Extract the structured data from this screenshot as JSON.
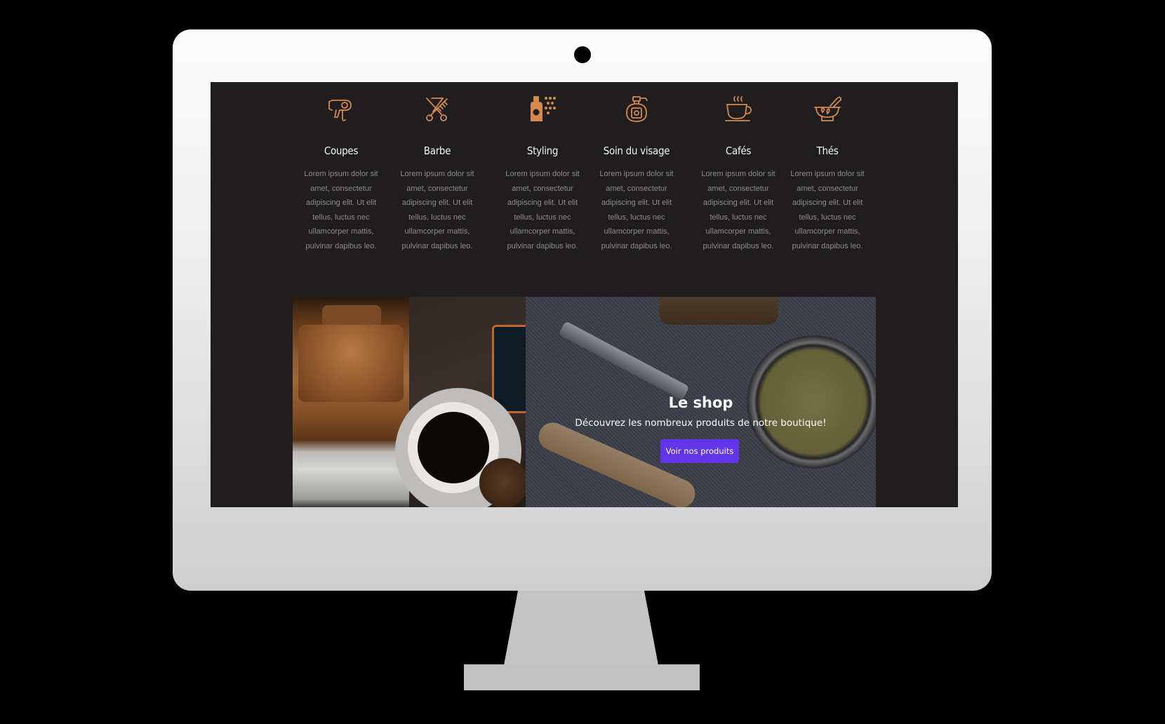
{
  "brand": {
    "accent_color": "#d58a4c",
    "button_color": "#6235e8",
    "screen_background": "#1f1d1e"
  },
  "services": [
    {
      "icon": "hair-dryer-icon",
      "title": "Coupes",
      "text": "Lorem ipsum dolor sit amet, consectetur adipiscing elit. Ut elit tellus, luctus nec ullamcorper mattis, pulvinar dapibus leo."
    },
    {
      "icon": "scissors-comb-icon",
      "title": "Barbe",
      "text": "Lorem ipsum dolor sit amet, consectetur adipiscing elit. Ut elit tellus, luctus nec ullamcorper mattis, pulvinar dapibus leo."
    },
    {
      "icon": "spray-bottle-icon",
      "title": "Styling",
      "text": "Lorem ipsum dolor sit amet, consectetur adipiscing elit. Ut elit tellus, luctus nec ullamcorper mattis, pulvinar dapibus leo."
    },
    {
      "icon": "perfume-bottle-icon",
      "title": "Soin du visage",
      "text": "Lorem ipsum dolor sit amet, consectetur adipiscing elit. Ut elit tellus, luctus nec ullamcorper mattis, pulvinar dapibus leo."
    },
    {
      "icon": "coffee-cup-icon",
      "title": "Cafés",
      "text": "Lorem ipsum dolor sit amet, consectetur adipiscing elit. Ut elit tellus, luctus nec ullamcorper mattis, pulvinar dapibus leo."
    },
    {
      "icon": "mortar-pestle-icon",
      "title": "Thés",
      "text": "Lorem ipsum dolor sit amet, consectetur adipiscing elit. Ut elit tellus, luctus nec ullamcorper mattis, pulvinar dapibus leo."
    }
  ],
  "shop": {
    "title": "Le shop",
    "subtitle": "Découvrez les nombreux produits de notre boutique!",
    "button_label": "Voir nos produits"
  }
}
